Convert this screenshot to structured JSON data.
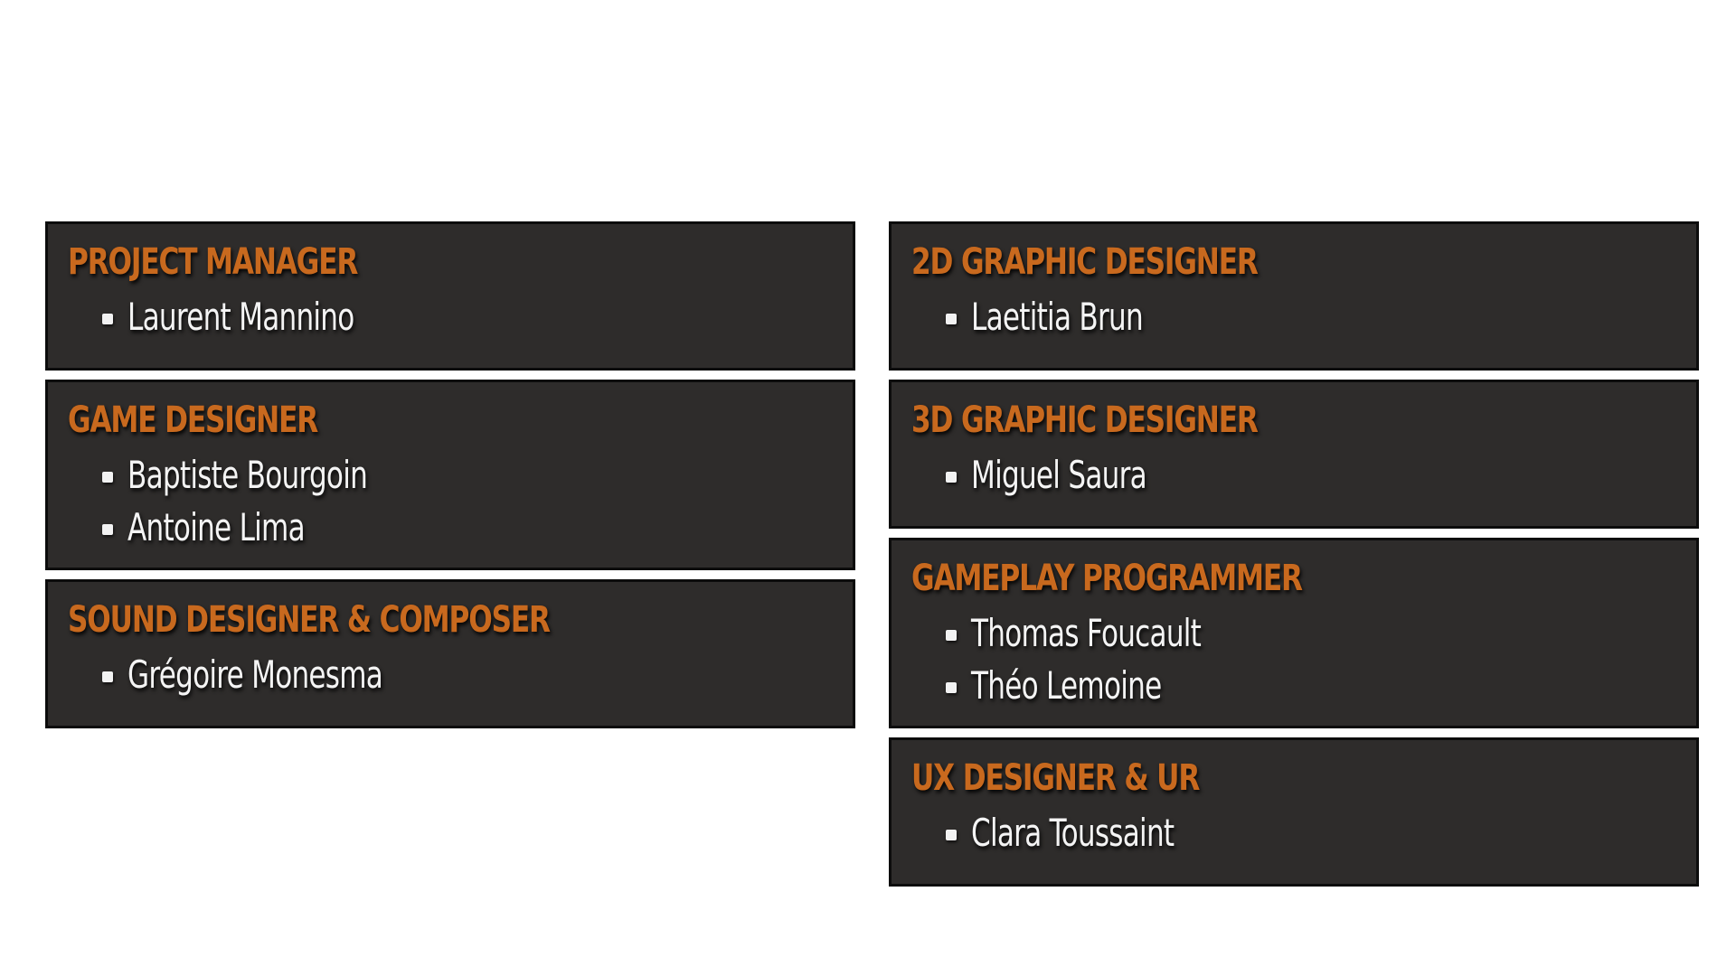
{
  "left_column": [
    {
      "role": "PROJECT MANAGER",
      "members": [
        "Laurent Mannino"
      ]
    },
    {
      "role": "GAME DESIGNER",
      "members": [
        "Baptiste Bourgoin",
        "Antoine Lima"
      ]
    },
    {
      "role": "SOUND DESIGNER & COMPOSER",
      "members": [
        "Grégoire Monesma"
      ]
    }
  ],
  "right_column": [
    {
      "role": "2D GRAPHIC DESIGNER",
      "members": [
        "Laetitia Brun"
      ]
    },
    {
      "role": "3D GRAPHIC DESIGNER",
      "members": [
        "Miguel Saura"
      ]
    },
    {
      "role": "GAMEPLAY PROGRAMMER",
      "members": [
        "Thomas Foucault",
        "Théo Lemoine"
      ]
    },
    {
      "role": "UX DESIGNER & UR",
      "members": [
        "Clara Toussaint"
      ]
    }
  ],
  "colors": {
    "background": "#ffffff",
    "card_background": "#2e2c2b",
    "card_border": "#0c0c0c",
    "role_text": "#c8691e",
    "member_text": "#f4f4f4"
  },
  "icons": {
    "bullet": "square-bullet-icon"
  }
}
